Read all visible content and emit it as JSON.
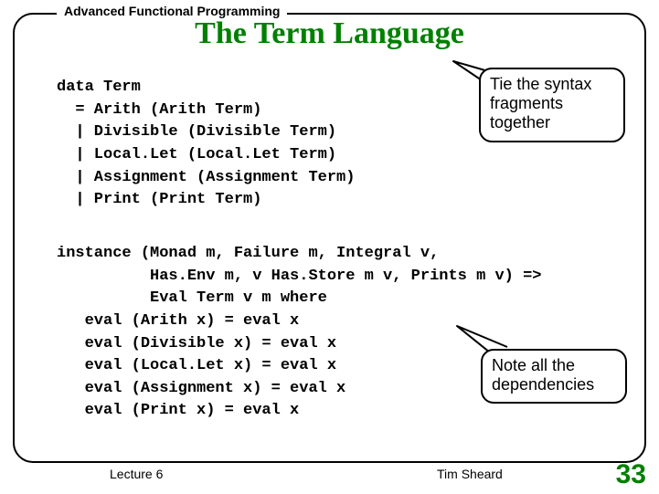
{
  "header": {
    "topic": "Advanced Functional Programming",
    "title": "The Term Language"
  },
  "code": {
    "block1": "data Term\n  = Arith (Arith Term)\n  | Divisible (Divisible Term)\n  | Local.Let (Local.Let Term)\n  | Assignment (Assignment Term)\n  | Print (Print Term)",
    "block2": "instance (Monad m, Failure m, Integral v,\n          Has.Env m, v Has.Store m v, Prints m v) =>\n          Eval Term v m where\n   eval (Arith x) = eval x\n   eval (Divisible x) = eval x\n   eval (Local.Let x) = eval x\n   eval (Assignment x) = eval x\n   eval (Print x) = eval x"
  },
  "callouts": {
    "c1": "Tie the syntax fragments together",
    "c2": "Note all the dependencies"
  },
  "footer": {
    "lecture": "Lecture 6",
    "author": "Tim Sheard",
    "page": "33"
  }
}
